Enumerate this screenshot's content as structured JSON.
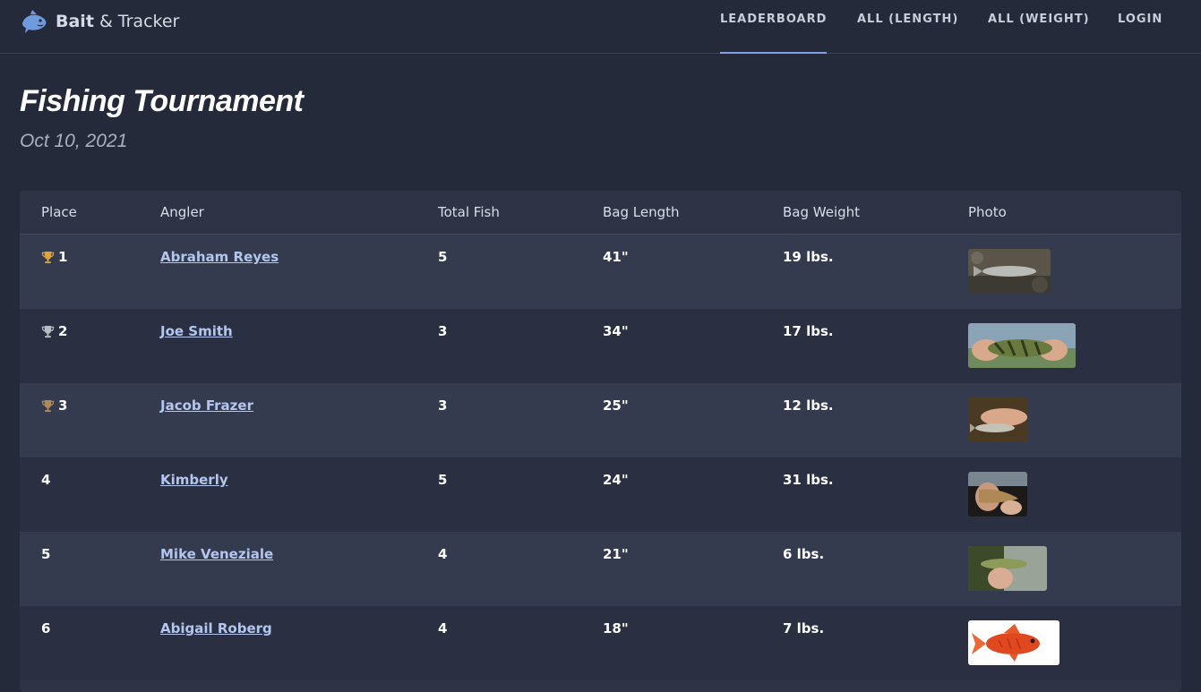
{
  "brand": {
    "bold": "Bait",
    "rest": " & Tracker"
  },
  "nav": {
    "leaderboard": "LEADERBOARD",
    "all_length": "ALL (LENGTH)",
    "all_weight": "ALL (WEIGHT)",
    "login": "LOGIN",
    "active": "leaderboard"
  },
  "page": {
    "title": "Fishing Tournament",
    "date": "Oct 10, 2021"
  },
  "table": {
    "headers": {
      "place": "Place",
      "angler": "Angler",
      "total_fish": "Total Fish",
      "bag_length": "Bag Length",
      "bag_weight": "Bag Weight",
      "photo": "Photo"
    },
    "rows": [
      {
        "place": "1",
        "trophy": "gold-trophy-icon",
        "angler": "Abraham Reyes",
        "total_fish": "5",
        "bag_length": "41\"",
        "bag_weight": "19 lbs."
      },
      {
        "place": "2",
        "trophy": "silver-trophy-icon",
        "angler": "Joe Smith",
        "total_fish": "3",
        "bag_length": "34\"",
        "bag_weight": "17 lbs."
      },
      {
        "place": "3",
        "trophy": "bronze-trophy-icon",
        "angler": "Jacob Frazer",
        "total_fish": "3",
        "bag_length": "25\"",
        "bag_weight": "12 lbs."
      },
      {
        "place": "4",
        "trophy": "",
        "angler": "Kimberly",
        "total_fish": "5",
        "bag_length": "24\"",
        "bag_weight": "31 lbs."
      },
      {
        "place": "5",
        "trophy": "",
        "angler": "Mike Veneziale",
        "total_fish": "4",
        "bag_length": "21\"",
        "bag_weight": "6 lbs."
      },
      {
        "place": "6",
        "trophy": "",
        "angler": "Abigail Roberg",
        "total_fish": "4",
        "bag_length": "18\"",
        "bag_weight": "7 lbs."
      }
    ]
  },
  "colors": {
    "background": "#252a3a",
    "table_bg": "#2e3446",
    "row_alt": "#353b4e",
    "link": "#b4c6ee",
    "accent": "#7da2de",
    "gold": "#d9a441",
    "silver": "#b8bcc4",
    "bronze": "#b08a5c"
  }
}
